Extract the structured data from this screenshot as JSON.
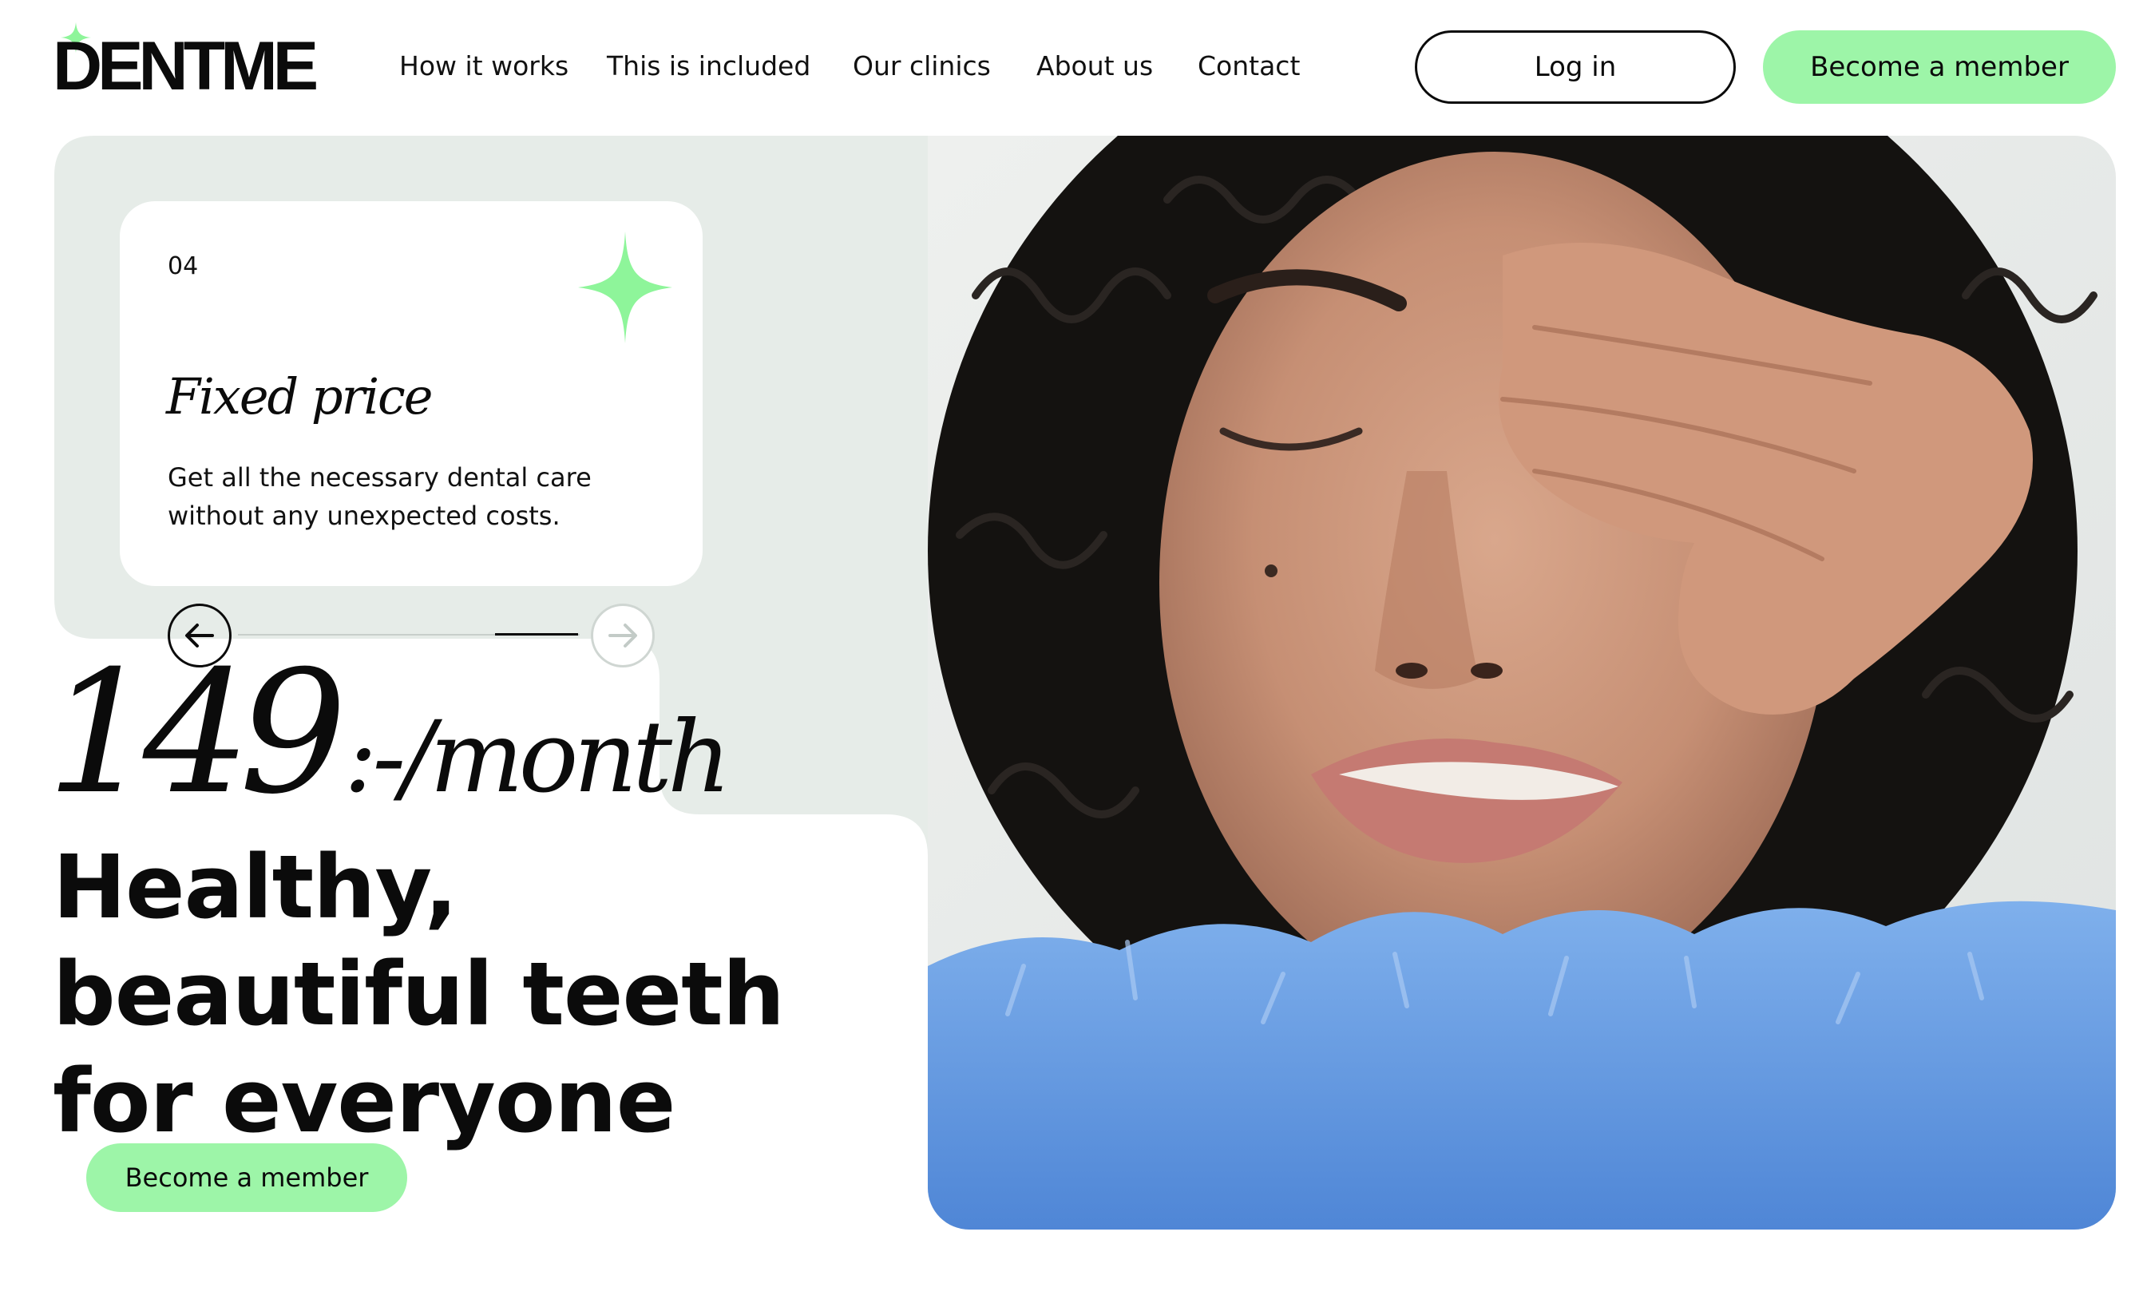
{
  "brand": {
    "name": "DENTME",
    "accent_color": "#9df5a8",
    "star_color": "#8ef59a",
    "panel_color": "#e6ece8"
  },
  "nav": {
    "items": [
      {
        "label": "How it works"
      },
      {
        "label": "This is included"
      },
      {
        "label": "Our clinics"
      },
      {
        "label": "About us"
      },
      {
        "label": "Contact"
      }
    ]
  },
  "header": {
    "login_label": "Log in",
    "member_label": "Become a member"
  },
  "card": {
    "number": "04",
    "title": "Fixed price",
    "description": "Get all the necessary dental care without any unexpected costs.",
    "icon": "sparkle-star-icon"
  },
  "slider": {
    "prev_icon": "arrow-left-icon",
    "next_icon": "arrow-right-icon"
  },
  "price": {
    "amount": "149",
    "unit": ":-/month"
  },
  "hero": {
    "headline_lines": [
      "Healthy,",
      "beautiful teeth",
      "for everyone"
    ],
    "cta_label": "Become a member",
    "photo": "woman-covering-eye-photo"
  }
}
